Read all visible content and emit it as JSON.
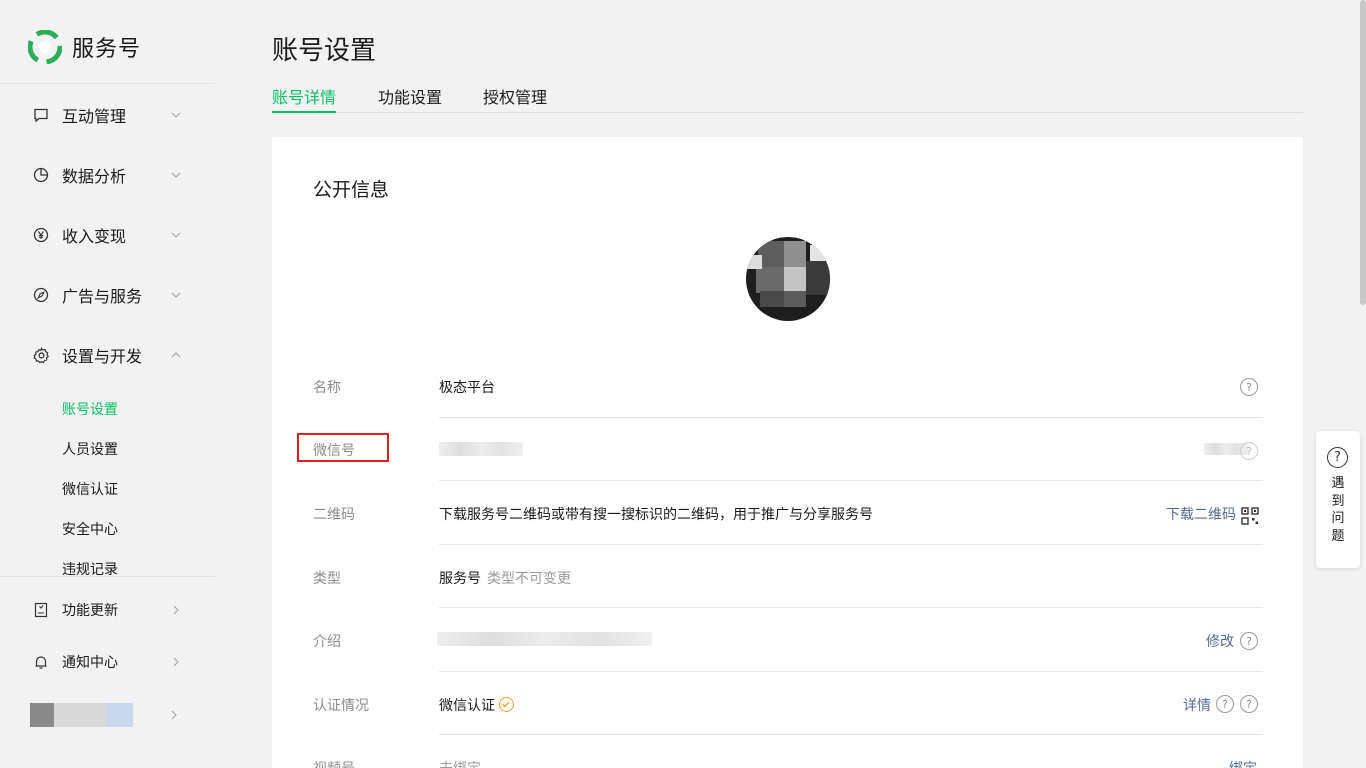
{
  "brand": {
    "name": "服务号",
    "logo_icon": "wechat-service-logo-icon",
    "accent": "#07c160"
  },
  "sidebar": {
    "groups": [
      {
        "label": "互动管理",
        "icon": "chat-bubble-icon",
        "expanded": false
      },
      {
        "label": "数据分析",
        "icon": "pie-chart-icon",
        "expanded": false
      },
      {
        "label": "收入变现",
        "icon": "yen-circle-icon",
        "expanded": false
      },
      {
        "label": "广告与服务",
        "icon": "compass-icon",
        "expanded": false
      },
      {
        "label": "设置与开发",
        "icon": "gear-icon",
        "expanded": true
      }
    ],
    "sub_items": [
      {
        "label": "账号设置",
        "active": true
      },
      {
        "label": "人员设置",
        "active": false
      },
      {
        "label": "微信认证",
        "active": false
      },
      {
        "label": "安全中心",
        "active": false
      },
      {
        "label": "违规记录",
        "active": false
      }
    ],
    "bottom": [
      {
        "label": "功能更新",
        "icon": "document-icon"
      },
      {
        "label": "通知中心",
        "icon": "bell-icon"
      }
    ]
  },
  "page": {
    "title": "账号设置",
    "tabs": [
      {
        "label": "账号详情",
        "active": true
      },
      {
        "label": "功能设置",
        "active": false
      },
      {
        "label": "授权管理",
        "active": false
      }
    ]
  },
  "card": {
    "title": "公开信息",
    "rows": [
      {
        "label": "名称",
        "value": "极态平台",
        "action": ""
      },
      {
        "label": "微信号",
        "value": "",
        "action": ""
      },
      {
        "label": "二维码",
        "value": "下载服务号二维码或带有搜一搜标识的二维码，用于推广与分享服务号",
        "action": "下载二维码"
      },
      {
        "label": "类型",
        "value": "服务号",
        "sub": "类型不可变更",
        "action": ""
      },
      {
        "label": "介绍",
        "value": "",
        "action": "修改"
      },
      {
        "label": "认证情况",
        "value": "微信认证",
        "action": "详情"
      },
      {
        "label": "视频号",
        "value": "未绑定",
        "action": "绑定"
      }
    ]
  },
  "help_float": {
    "label": "遇到问题"
  }
}
